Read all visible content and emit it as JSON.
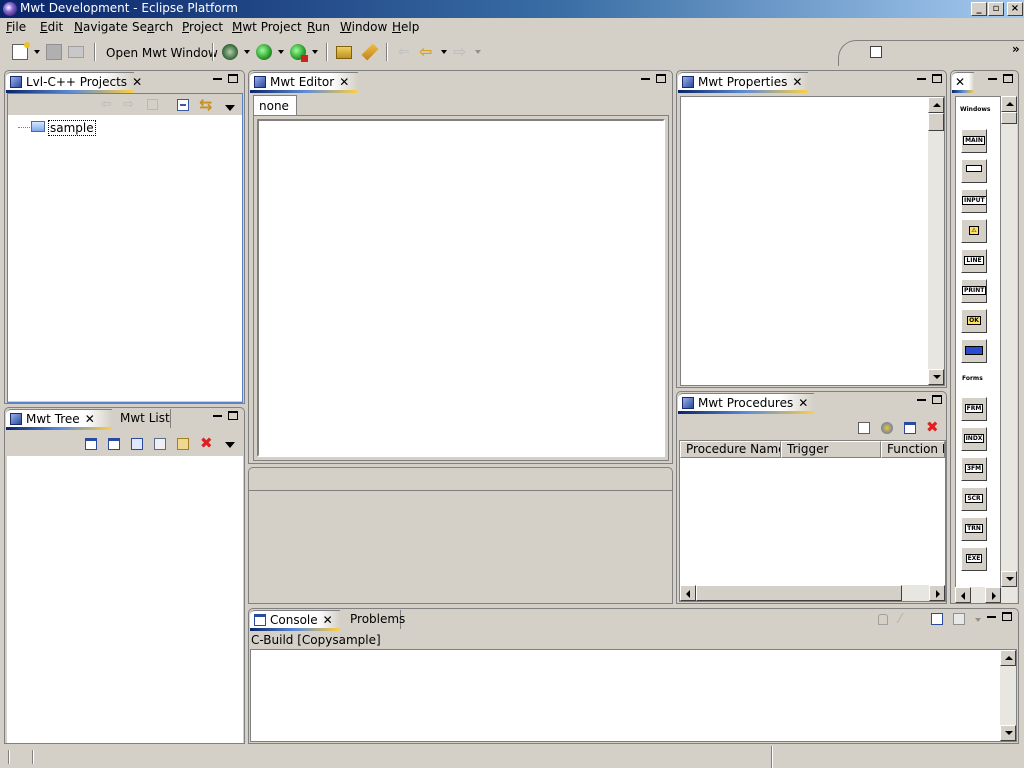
{
  "window": {
    "title": "Mwt Development - Eclipse Platform",
    "controls": {
      "minimize": "_",
      "maximize": "▫",
      "close": "×"
    }
  },
  "menu": [
    {
      "key": "F",
      "rest": "ile"
    },
    {
      "key": "E",
      "rest": "dit"
    },
    {
      "key": "N",
      "rest": "avigate"
    },
    {
      "key": "",
      "pre": "Se",
      "u": "a",
      "rest": "rch"
    },
    {
      "key": "P",
      "rest": "roject"
    },
    {
      "key": "M",
      "rest": "wt Project"
    },
    {
      "key": "R",
      "rest": "un"
    },
    {
      "key": "W",
      "rest": "indow"
    },
    {
      "key": "H",
      "rest": "elp"
    }
  ],
  "toolbar": {
    "open_mwt_window": "Open Mwt Window",
    "overflow": "»"
  },
  "projects_panel": {
    "tab_label": "Lvl-C++ Projects",
    "tree": [
      {
        "label": "sample",
        "icon": "folder-icon"
      }
    ]
  },
  "tree_panel": {
    "tabs": [
      "Mwt Tree",
      "Mwt List"
    ]
  },
  "editor_panel": {
    "tab_label": "Mwt Editor",
    "inner_tab": "none"
  },
  "properties_panel": {
    "tab_label": "Mwt Properties"
  },
  "procedures_panel": {
    "tab_label": "Mwt Procedures",
    "columns": [
      "Procedure Name",
      "Trigger",
      "Function Na"
    ]
  },
  "palette": {
    "section_windows": "Windows",
    "section_forms": "Forms",
    "window_items": [
      "MAIN",
      "",
      "INPUT",
      "⚠",
      "LINE",
      "PRINT",
      "OK",
      "BAR"
    ],
    "form_items": [
      "FRM",
      "INDX",
      "3FM",
      "SCR",
      "TRN",
      "EXE"
    ]
  },
  "console_panel": {
    "tabs": [
      "Console",
      "Problems"
    ],
    "text": "C-Build [Copysample]"
  },
  "colors": {
    "titlebar_start": "#0a246a",
    "titlebar_end": "#a6caf0",
    "chrome": "#d4d0c8"
  }
}
